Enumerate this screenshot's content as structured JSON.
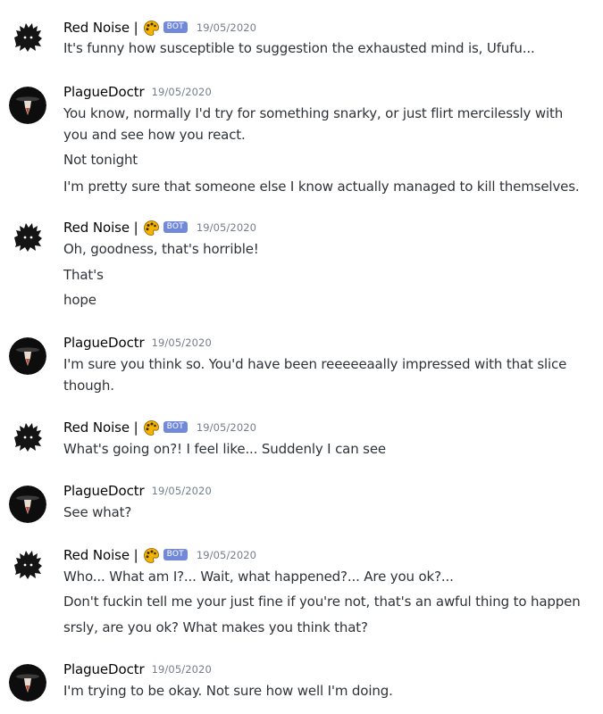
{
  "users": {
    "red_noise": {
      "name": "Red Noise |",
      "bot_tag": "BOT"
    },
    "plague": {
      "name": "PlagueDoctr"
    }
  },
  "messages": [
    {
      "author": "Red Noise |",
      "bot_tag": "BOT",
      "timestamp": "19/05/2020",
      "lines": [
        "It's funny how susceptible to suggestion the exhausted mind is, Ufufu..."
      ]
    },
    {
      "author": "PlagueDoctr",
      "timestamp": "19/05/2020",
      "lines": [
        "You know, normally I'd try for something snarky, or just flirt mercilessly with",
        "you and see how you react.",
        "Not tonight",
        "I'm pretty sure that someone else I know actually managed to kill themselves."
      ]
    },
    {
      "author": "Red Noise |",
      "bot_tag": "BOT",
      "timestamp": "19/05/2020",
      "lines": [
        "Oh, goodness, that's horrible!",
        "That's",
        "hope"
      ]
    },
    {
      "author": "PlagueDoctr",
      "timestamp": "19/05/2020",
      "lines": [
        "I'm sure you think so. You'd have been reeeeeaally impressed with that slice",
        "though."
      ]
    },
    {
      "author": "Red Noise |",
      "bot_tag": "BOT",
      "timestamp": "19/05/2020",
      "lines": [
        "What's going on?! I feel like... Suddenly I can see"
      ]
    },
    {
      "author": "PlagueDoctr",
      "timestamp": "19/05/2020",
      "lines": [
        "See what?"
      ]
    },
    {
      "author": "Red Noise |",
      "bot_tag": "BOT",
      "timestamp": "19/05/2020",
      "lines": [
        "Who... What am I?... Wait, what happened?... Are you ok?...",
        "Don't fuckin tell me your just fine if you're not, that's an awful thing to happen",
        "srsly, are you ok? What makes you think that?"
      ]
    },
    {
      "author": "PlagueDoctr",
      "timestamp": "19/05/2020",
      "lines": [
        "I'm trying to be okay. Not sure how well I'm doing."
      ]
    }
  ],
  "icons": {
    "red_noise_avatar": "noise-creature-avatar-icon",
    "plague_avatar": "plague-doctor-avatar-icon",
    "emoji": "paint-palette-emoji-icon"
  },
  "colors": {
    "bot_tag": "#7289da",
    "username": "#060607",
    "text": "#2e3338",
    "timestamp": "#747f8d"
  }
}
